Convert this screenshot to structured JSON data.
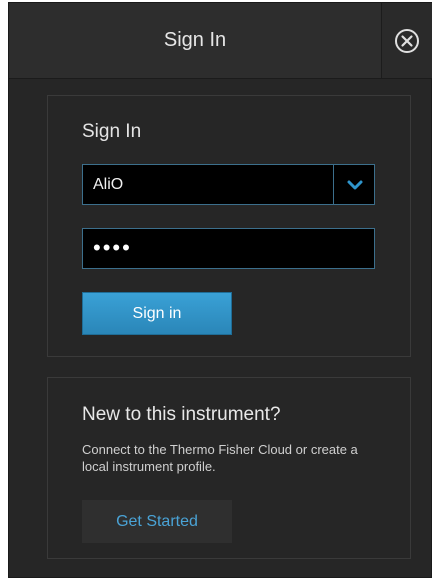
{
  "dialog": {
    "title": "Sign In",
    "close_icon": "close-circle-icon"
  },
  "signin_panel": {
    "heading": "Sign In",
    "user_select": {
      "value": "AliO",
      "chevron_icon": "chevron-down-icon"
    },
    "password": {
      "masked_value": "••••"
    },
    "button_label": "Sign in"
  },
  "new_panel": {
    "heading": "New to this instrument?",
    "description": "Connect to the Thermo Fisher Cloud or create a local instrument profile.",
    "button_label": "Get Started"
  },
  "colors": {
    "accent": "#2f95cc",
    "background": "#262626",
    "link": "#4aa3d6"
  }
}
